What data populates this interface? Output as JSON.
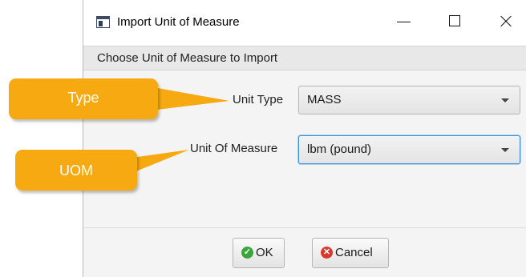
{
  "window": {
    "title": "Import Unit of Measure",
    "header": "Choose Unit of Measure to Import"
  },
  "form": {
    "unit_type_label": "Unit Type",
    "unit_type_value": "MASS",
    "unit_of_measure_label": "Unit Of Measure",
    "unit_of_measure_value": "lbm (pound)"
  },
  "buttons": {
    "ok_label": "OK",
    "cancel_label": "Cancel"
  },
  "callouts": {
    "type_label": "Type",
    "uom_label": "UOM"
  },
  "icons": {
    "app": "window-app-icon",
    "minimize": "minimize-icon",
    "maximize": "maximize-icon",
    "close": "close-icon",
    "dropdown": "chevron-down-icon",
    "ok": "check-circle-icon",
    "cancel": "x-circle-icon"
  },
  "colors": {
    "callout": "#f7a911",
    "focus_border": "#3a8fd6",
    "ok_icon": "#3aa53a",
    "cancel_icon": "#d7392f"
  }
}
